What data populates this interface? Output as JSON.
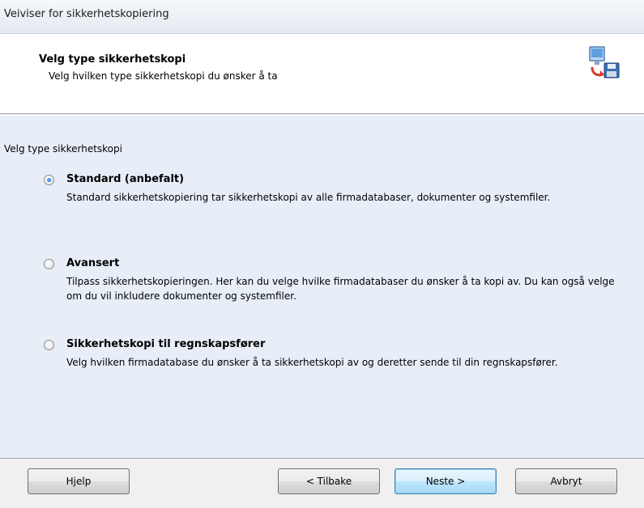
{
  "window": {
    "title": "Veiviser for sikkerhetskopiering"
  },
  "header": {
    "title": "Velg type sikkerhetskopi",
    "subtitle": "Velg hvilken type sikkerhetskopi du ønsker å ta",
    "icon": "backup-wizard-icon"
  },
  "body": {
    "group_label": "Velg type sikkerhetskopi",
    "options": [
      {
        "label": "Standard (anbefalt)",
        "description": "Standard sikkerhetskopiering tar sikkerhetskopi av alle firmadatabaser, dokumenter og systemfiler.",
        "checked": true
      },
      {
        "label": "Avansert",
        "description": "Tilpass sikkerhetskopieringen. Her kan du velge hvilke firmadatabaser du ønsker å ta kopi av. Du kan også velge om du vil inkludere dokumenter og systemfiler.",
        "checked": false
      },
      {
        "label": "Sikkerhetskopi til regnskapsfører",
        "description": "Velg hvilken firmadatabase du ønsker å ta sikkerhetskopi av og deretter sende til din regnskapsfører.",
        "checked": false
      }
    ]
  },
  "footer": {
    "help_label": "Hjelp",
    "back_label": "< Tilbake",
    "next_label": "Neste >",
    "cancel_label": "Avbryt"
  },
  "colors": {
    "body_background": "#e8eef8",
    "header_background": "#ffffff",
    "default_button_border": "#3c7fb1"
  }
}
